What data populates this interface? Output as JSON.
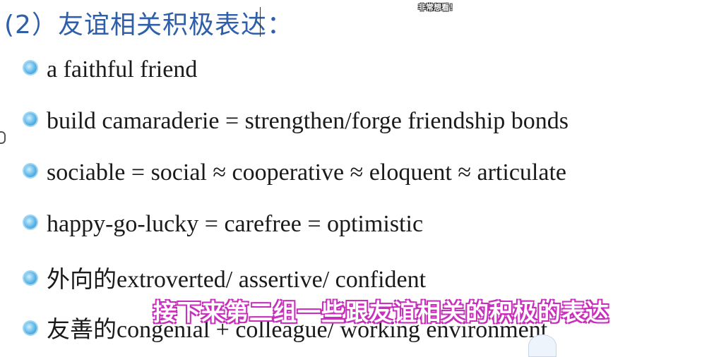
{
  "slide": {
    "title": "(2）友谊相关积极表达：",
    "top_caption": "非常想看！",
    "items": [
      {
        "zh": "",
        "en": "a faithful friend"
      },
      {
        "zh": "",
        "en": "build camaraderie = strengthen/forge friendship bonds"
      },
      {
        "zh": "",
        "en": "sociable = social ≈ cooperative ≈ eloquent ≈ articulate"
      },
      {
        "zh": "",
        "en": "happy-go-lucky = carefree = optimistic"
      },
      {
        "zh": "外向的",
        "en": "extroverted/ assertive/ confident"
      },
      {
        "zh": "友善的",
        "en": "congenial + colleague/ working environment"
      }
    ]
  },
  "subtitle": "接下来第二组一些跟友谊相关的积极的表达",
  "colors": {
    "title": "#2e5fa8",
    "text": "#1a1a1a",
    "bullet": "#5fb6e6",
    "subtitle_outline": "#c22fb6"
  },
  "icons": {
    "bullet": "round-blue-bullet-icon"
  }
}
